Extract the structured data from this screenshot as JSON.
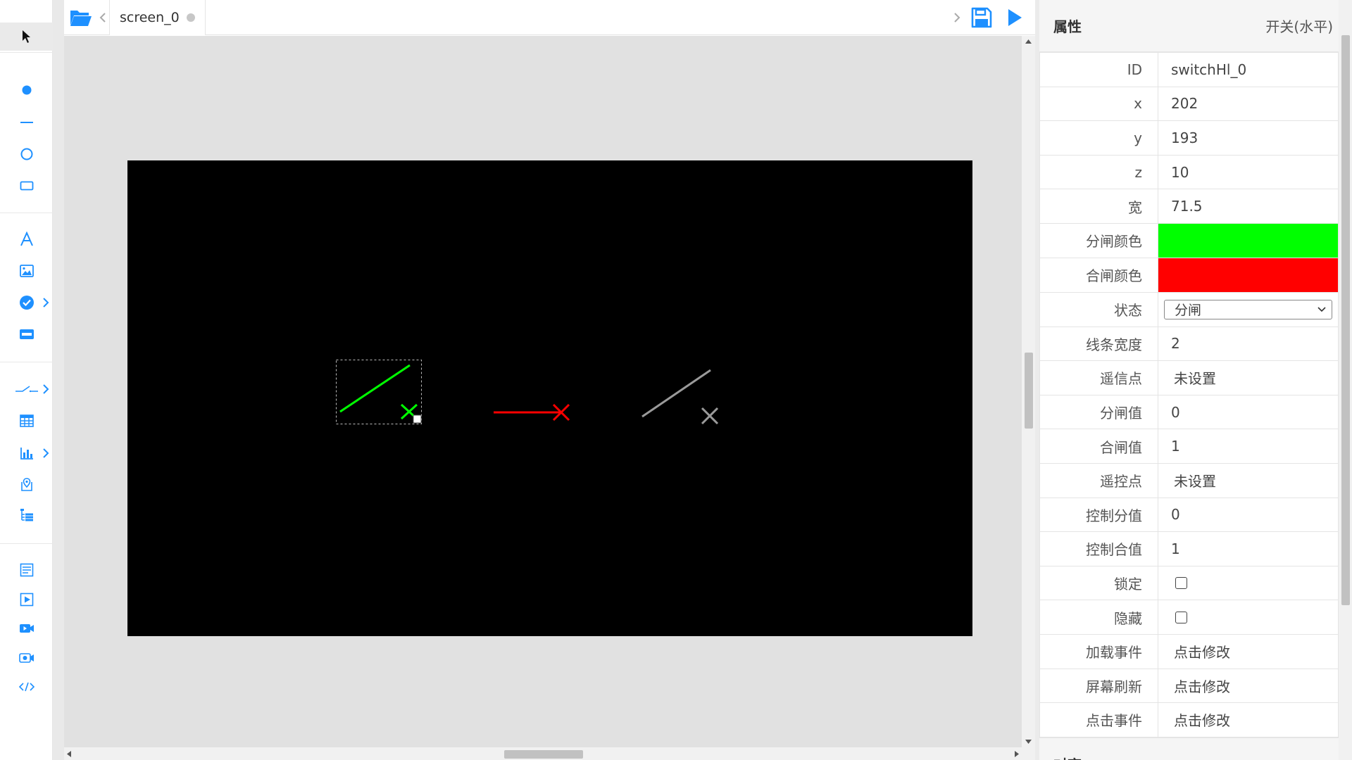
{
  "toolbar": {
    "tools": [
      {
        "name": "select-tool",
        "icon": "cursor-arrow-icon"
      },
      {
        "name": "point-tool",
        "icon": "dot-icon"
      },
      {
        "name": "line-tool",
        "icon": "line-icon"
      },
      {
        "name": "circle-tool",
        "icon": "circle-icon"
      },
      {
        "name": "rect-tool",
        "icon": "rectangle-icon"
      },
      {
        "name": "text-tool",
        "icon": "text-a-icon"
      },
      {
        "name": "image-tool",
        "icon": "image-icon"
      },
      {
        "name": "indicator-tool",
        "icon": "check-circle-icon"
      },
      {
        "name": "button-tool",
        "icon": "button-icon"
      },
      {
        "name": "switch-tool",
        "icon": "switch-icon"
      },
      {
        "name": "table-tool",
        "icon": "table-icon"
      },
      {
        "name": "chart-tool",
        "icon": "bar-chart-icon"
      },
      {
        "name": "map-tool",
        "icon": "map-pin-icon"
      },
      {
        "name": "tree-tool",
        "icon": "tree-list-icon"
      },
      {
        "name": "page-tool",
        "icon": "document-icon"
      },
      {
        "name": "media-tool",
        "icon": "play-frame-icon"
      },
      {
        "name": "video-tool",
        "icon": "video-camera-icon"
      },
      {
        "name": "camera-tool",
        "icon": "camera-icon"
      },
      {
        "name": "code-tool",
        "icon": "code-icon"
      }
    ],
    "accent": "#1e90ff"
  },
  "tabs": {
    "active_tab": "screen_0"
  },
  "canvas": {
    "background": "#000000",
    "switch_open_color": "#00ff00",
    "switch_closed_color": "#ff0000",
    "switch_disabled_color": "#9a9a9a"
  },
  "props": {
    "title": "属性",
    "type": "开关(水平)",
    "rows": {
      "id": {
        "label": "ID",
        "value": "switchHl_0"
      },
      "x": {
        "label": "x",
        "value": "202"
      },
      "y": {
        "label": "y",
        "value": "193"
      },
      "z": {
        "label": "z",
        "value": "10"
      },
      "width": {
        "label": "宽",
        "value": "71.5"
      },
      "open_color": {
        "label": "分闸颜色",
        "color": "#00ff00"
      },
      "close_color": {
        "label": "合闸颜色",
        "color": "#ff0000"
      },
      "state": {
        "label": "状态",
        "value": "分闸"
      },
      "line_width": {
        "label": "线条宽度",
        "value": "2"
      },
      "telesignal": {
        "label": "遥信点",
        "value": "未设置"
      },
      "open_value": {
        "label": "分闸值",
        "value": "0"
      },
      "close_value": {
        "label": "合闸值",
        "value": "1"
      },
      "telecontrol": {
        "label": "遥控点",
        "value": "未设置"
      },
      "ctrl_open": {
        "label": "控制分值",
        "value": "0"
      },
      "ctrl_close": {
        "label": "控制合值",
        "value": "1"
      },
      "lock": {
        "label": "锁定",
        "checked": false
      },
      "hidden": {
        "label": "隐藏",
        "checked": false
      },
      "load_event": {
        "label": "加载事件",
        "value": "点击修改"
      },
      "refresh_event": {
        "label": "屏幕刷新",
        "value": "点击修改"
      },
      "click_event": {
        "label": "点击事件",
        "value": "点击修改"
      }
    },
    "next_section": "对齐"
  }
}
